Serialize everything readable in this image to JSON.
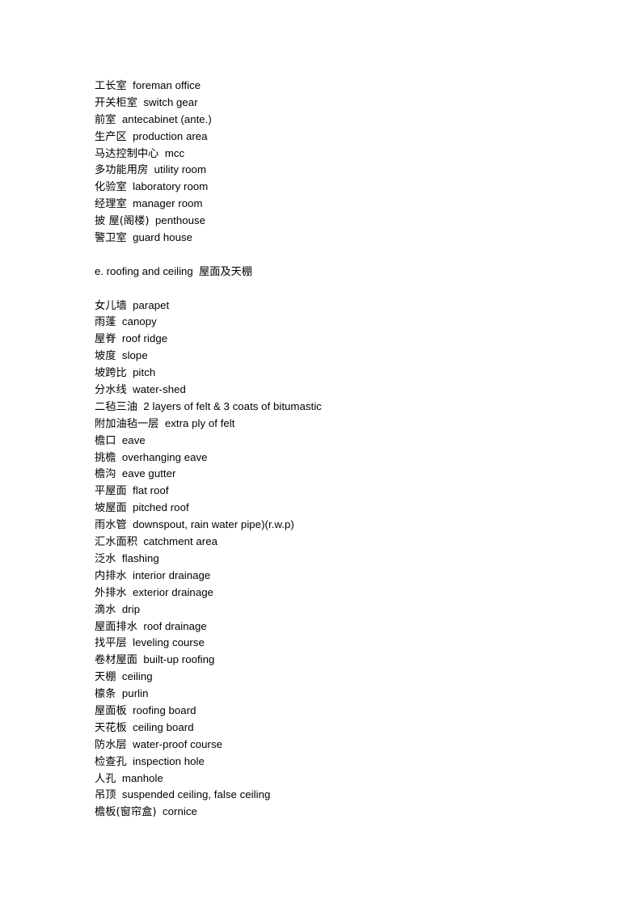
{
  "document": {
    "page_background": "#ffffff",
    "text_color": "#000000",
    "type": "bilingual-glossary"
  },
  "blocks": [
    {
      "kind": "list",
      "name": "rooms-list-continued",
      "entries": [
        {
          "term": "工长室",
          "gloss": "foreman office"
        },
        {
          "term": "开关柜室",
          "gloss": "switch gear"
        },
        {
          "term": "前室",
          "gloss": "antecabinet (ante.)"
        },
        {
          "term": "生产区",
          "gloss": "production area"
        },
        {
          "term": "马达控制中心",
          "gloss": "mcc"
        },
        {
          "term": "多功能用房",
          "gloss": "utility room"
        },
        {
          "term": "化验室",
          "gloss": "laboratory room"
        },
        {
          "term": "经理室",
          "gloss": "manager room"
        },
        {
          "term": "披 屋(阁楼)",
          "gloss": "penthouse"
        },
        {
          "term": "警卫室",
          "gloss": "guard house"
        }
      ]
    },
    {
      "kind": "blank",
      "name": "spacer-after-rooms",
      "count": 1
    },
    {
      "kind": "heading",
      "name": "section-heading-roofing",
      "label_en": "e. roofing and ceiling",
      "label_zh": "屋面及天棚",
      "full": "e. roofing and ceiling  屋面及天棚"
    },
    {
      "kind": "blank",
      "name": "spacer-after-heading",
      "count": 1
    },
    {
      "kind": "list",
      "name": "roofing-and-ceiling-list",
      "entries": [
        {
          "term": "女儿墙",
          "gloss": "parapet"
        },
        {
          "term": "雨蓬",
          "gloss": "canopy"
        },
        {
          "term": "屋脊",
          "gloss": "roof ridge"
        },
        {
          "term": "坡度",
          "gloss": "slope"
        },
        {
          "term": "坡跨比",
          "gloss": "pitch"
        },
        {
          "term": "分水线",
          "gloss": "water-shed"
        },
        {
          "term": "二毡三油",
          "gloss": "2 layers of felt & 3 coats of bitumastic"
        },
        {
          "term": "附加油毡一层",
          "gloss": "extra ply of felt"
        },
        {
          "term": "檐口",
          "gloss": "eave"
        },
        {
          "term": "挑檐",
          "gloss": "overhanging eave"
        },
        {
          "term": "檐沟",
          "gloss": "eave gutter"
        },
        {
          "term": "平屋面",
          "gloss": "flat roof"
        },
        {
          "term": "坡屋面",
          "gloss": "pitched roof"
        },
        {
          "term": "雨水管",
          "gloss": "downspout, rain water pipe)(r.w.p)"
        },
        {
          "term": "汇水面积",
          "gloss": "catchment area"
        },
        {
          "term": "泛水",
          "gloss": "flashing"
        },
        {
          "term": "内排水",
          "gloss": "interior drainage"
        },
        {
          "term": "外排水",
          "gloss": "exterior drainage"
        },
        {
          "term": "滴水",
          "gloss": "drip"
        },
        {
          "term": "屋面排水",
          "gloss": "roof drainage"
        },
        {
          "term": "找平层",
          "gloss": "leveling course"
        },
        {
          "term": "卷材屋面",
          "gloss": "built-up roofing"
        },
        {
          "term": "天棚",
          "gloss": "ceiling"
        },
        {
          "term": "檩条",
          "gloss": "purlin"
        },
        {
          "term": "屋面板",
          "gloss": "roofing board"
        },
        {
          "term": "天花板",
          "gloss": "ceiling board"
        },
        {
          "term": "防水层",
          "gloss": "water-proof course"
        },
        {
          "term": "检查孔",
          "gloss": "inspection hole"
        },
        {
          "term": "人孔",
          "gloss": "manhole"
        },
        {
          "term": "吊顶",
          "gloss": "suspended ceiling, false ceiling"
        },
        {
          "term": "檐板(窗帘盒)",
          "gloss": "cornice"
        }
      ]
    }
  ]
}
